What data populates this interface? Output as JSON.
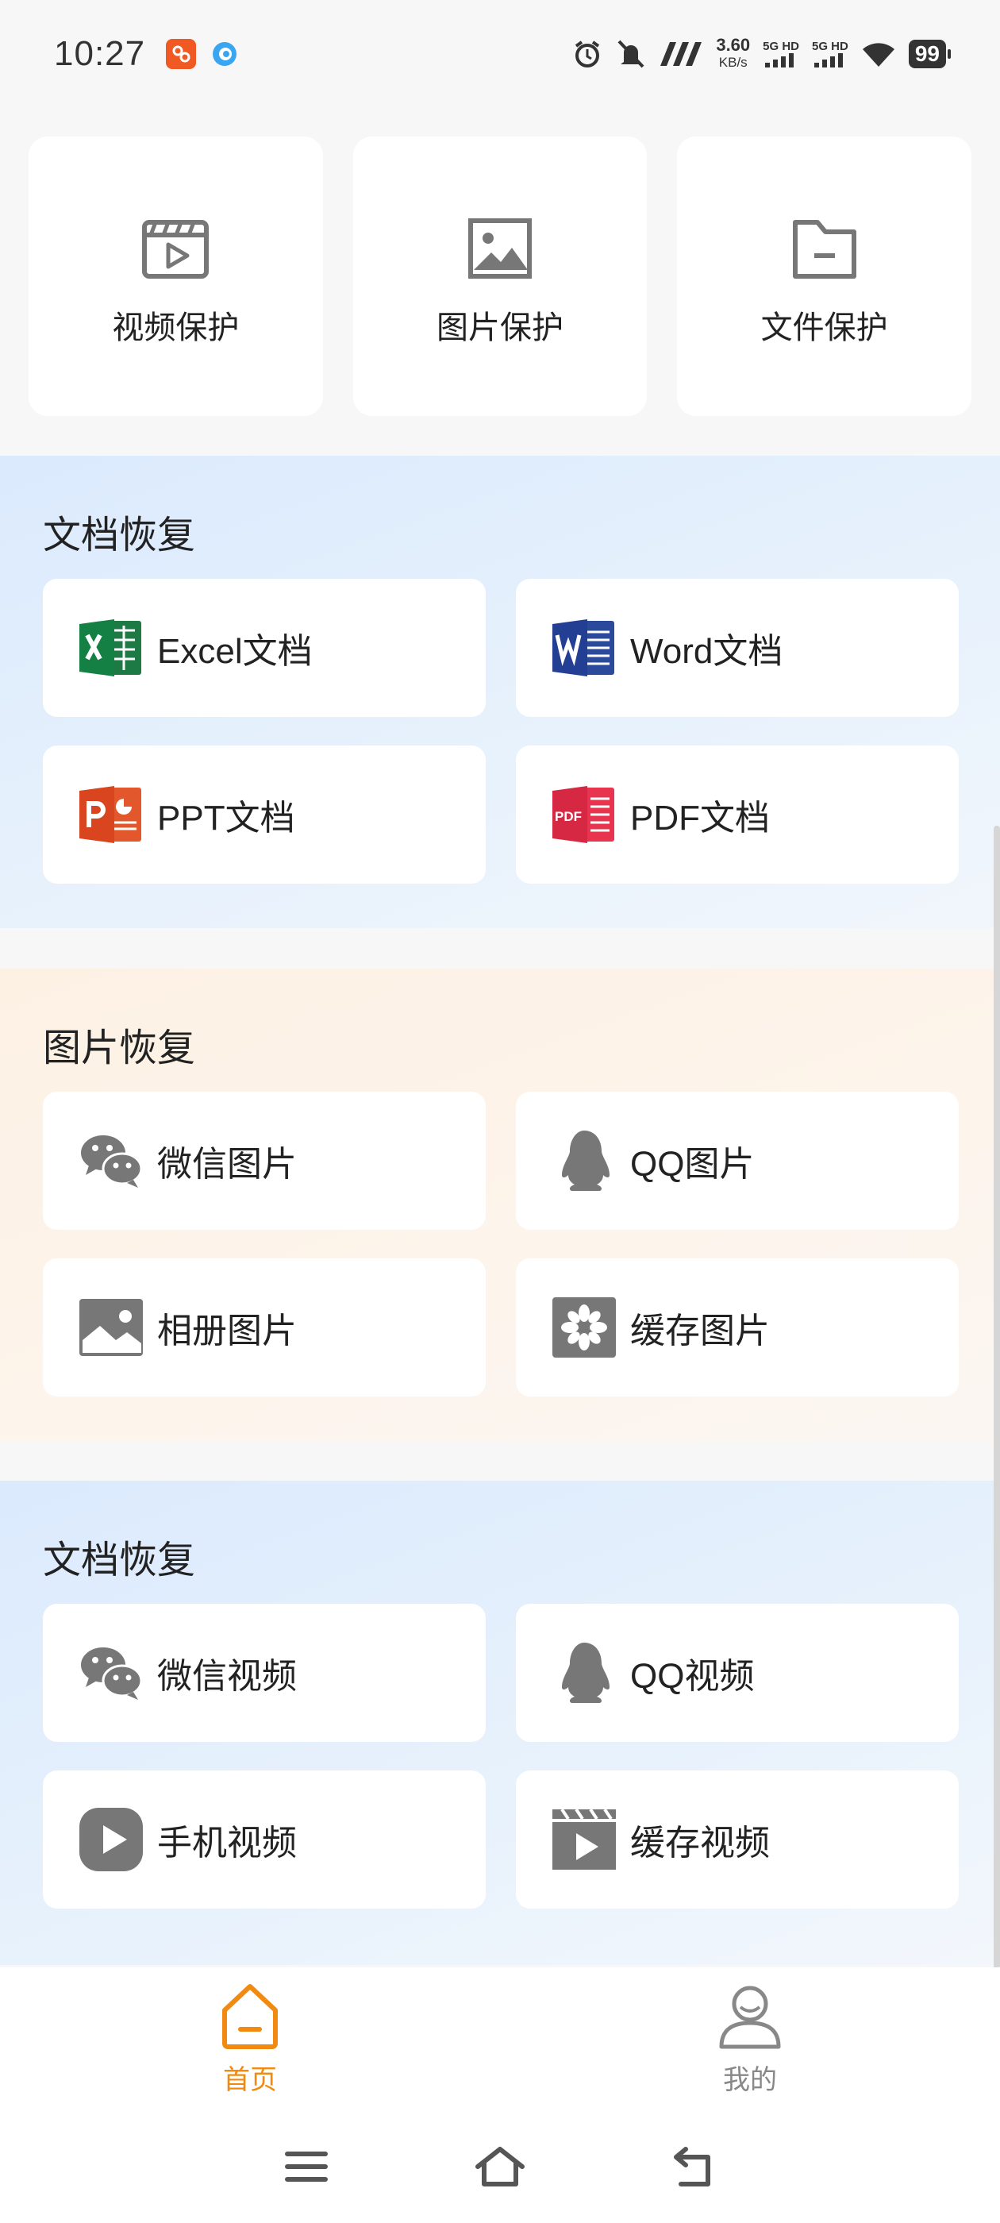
{
  "status_bar": {
    "time": "10:27",
    "net_speed": "3.60",
    "net_unit": "KB/s",
    "sim1": "5G HD",
    "sim2": "5G HD",
    "battery": "99"
  },
  "protection": [
    {
      "label": "视频保护",
      "icon": "video-file-icon"
    },
    {
      "label": "图片保护",
      "icon": "image-icon"
    },
    {
      "label": "文件保护",
      "icon": "folder-icon"
    }
  ],
  "sections": {
    "doc": {
      "title": "文档恢复",
      "items": [
        {
          "label": "Excel文档",
          "icon": "excel-icon"
        },
        {
          "label": "Word文档",
          "icon": "word-icon"
        },
        {
          "label": "PPT文档",
          "icon": "ppt-icon"
        },
        {
          "label": "PDF文档",
          "icon": "pdf-icon"
        }
      ]
    },
    "image": {
      "title": "图片恢复",
      "items": [
        {
          "label": "微信图片",
          "icon": "wechat-icon"
        },
        {
          "label": "QQ图片",
          "icon": "qq-icon"
        },
        {
          "label": "相册图片",
          "icon": "album-icon"
        },
        {
          "label": "缓存图片",
          "icon": "cache-image-icon"
        }
      ]
    },
    "video": {
      "title": "文档恢复",
      "items": [
        {
          "label": "微信视频",
          "icon": "wechat-icon"
        },
        {
          "label": "QQ视频",
          "icon": "qq-icon"
        },
        {
          "label": "手机视频",
          "icon": "play-icon"
        },
        {
          "label": "缓存视频",
          "icon": "cache-video-icon"
        }
      ]
    }
  },
  "bottom_nav": {
    "home": "首页",
    "mine": "我的",
    "active_color": "#f08a10",
    "inactive_color": "#888888"
  }
}
